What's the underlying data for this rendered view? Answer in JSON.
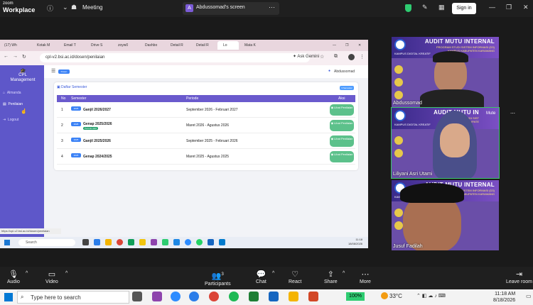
{
  "zoom": {
    "app_name_top": "zoom",
    "app_name_bottom": "Workplace",
    "meeting_label": "Meeting",
    "share_label": "Abdussomad's screen",
    "share_initial": "A",
    "signin_label": "Sign in"
  },
  "chrome": {
    "tabs": [
      "(17) Wh",
      "Kotak M",
      "Email T",
      "Drive S",
      "zoyw0",
      "Dashbo",
      "Detail R",
      "Detail R",
      "Lo",
      "Mata K"
    ],
    "url": "cpl-v2.bsi.ac.id/dosen/penilaian",
    "gemini_label": "Ask Gemini"
  },
  "app": {
    "logo_title": "CPL Management",
    "nav": [
      {
        "label": "Almanda"
      },
      {
        "label": "Penilaian"
      },
      {
        "label": "Logout"
      }
    ],
    "env_badge": "Dosen",
    "user_name": "Abdussomad",
    "card_title": "Daftar Semester",
    "card_pill": "3 Semester",
    "columns": [
      "No",
      "Semester",
      "Periode",
      "Aksi"
    ],
    "rows": [
      {
        "no": "1",
        "tag": "2026",
        "semester": "Ganjil 2026/2027",
        "active": "",
        "periode": "September 2026 - Februari 2027",
        "action": "Lihat Penilaian"
      },
      {
        "no": "2",
        "tag": "2026",
        "semester": "Genap 2025/2026",
        "active": "Periode Aktif",
        "periode": "Maret 2026 - Agustus 2026",
        "action": "Lihat Penilaian"
      },
      {
        "no": "3",
        "tag": "2025",
        "semester": "Ganjil 2025/2026",
        "active": "",
        "periode": "September 2025 - Februari 2026",
        "action": "Lihat Penilaian"
      },
      {
        "no": "4",
        "tag": "2025",
        "semester": "Genap 2024/2025",
        "active": "",
        "periode": "Maret 2025 - Agustus 2025",
        "action": "Lihat Penilaian"
      }
    ],
    "status_url": "https://cpl-v2.bsi.ac.id/dosen/penilaian"
  },
  "inner_taskbar": {
    "search_placeholder": "Search",
    "time": "11:18",
    "date": "18/08/2026"
  },
  "participants": [
    {
      "name": "Abdussomad",
      "banner_title": "AUDIT MUTU INTERNAL",
      "banner_sub1": "PROGRAM STUDI SISTEM INFORMASI (D3)",
      "banner_sub2": "KAMPUS KABUPATEN KARAWANG"
    },
    {
      "name": "Liliyani Asri Utami",
      "banner_title": "AUDIT MUTU IN",
      "banner_sub1": "PROGRAM STUDI SIST",
      "banner_sub2": "KAMPUS KABUPATE",
      "tag": "Mute"
    },
    {
      "name": "Jusuf Fadilah",
      "banner_title": "AUDIT MUTU INTERNAL",
      "banner_sub1": "STUDI SISTEM INFORMASI (D3)",
      "banner_sub2": "US KABUPATEN KARAWANG"
    }
  ],
  "campus_logo_text": "KAMPUS DIGITAL KREATIF",
  "toolbar": {
    "audio": "Audio",
    "video": "Video",
    "participants": "Participants",
    "participants_count": "3",
    "chat": "Chat",
    "react": "React",
    "share": "Share",
    "more": "More",
    "leave": "Leave room"
  },
  "windows": {
    "search_placeholder": "Type here to search",
    "battery": "100%",
    "weather": "33°C",
    "time": "11:18 AM",
    "date": "8/18/2026"
  },
  "colors": {
    "sidebar": "#5e57c9",
    "table_header": "#6a5acd",
    "action_button": "#5cc18b",
    "active_speaker": "#3cc36a"
  }
}
